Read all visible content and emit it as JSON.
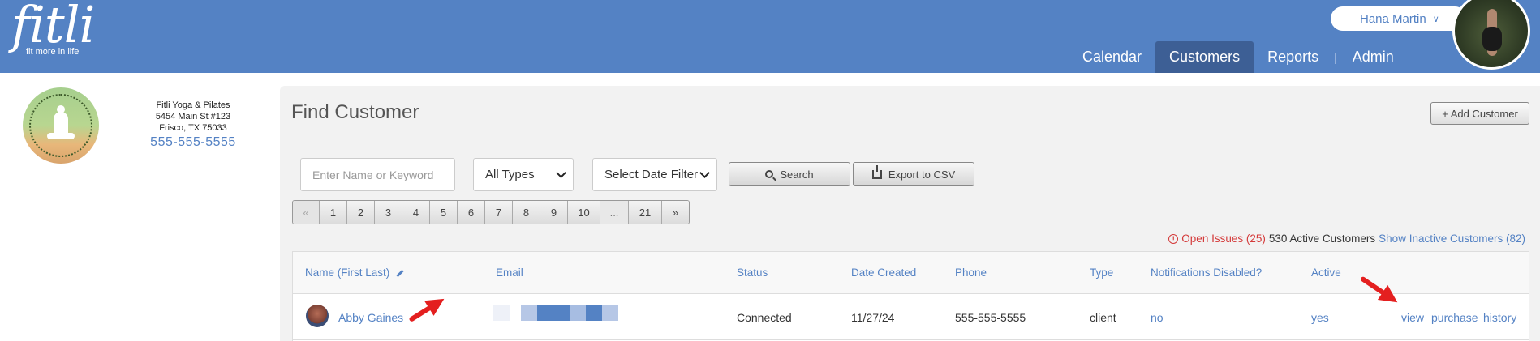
{
  "brand": {
    "name": "fitli",
    "tagline": "fit more in life"
  },
  "user": {
    "name": "Hana Martin"
  },
  "nav": {
    "items": [
      "Calendar",
      "Customers",
      "Reports",
      "Admin"
    ],
    "active": "Customers"
  },
  "studio": {
    "name": "Fitli Yoga & Pilates",
    "address1": "5454 Main St #123",
    "address2": "Frisco, TX 75033",
    "phone": "555-555-5555"
  },
  "page": {
    "title": "Find Customer",
    "add_label": "+ Add Customer"
  },
  "filters": {
    "keyword_placeholder": "Enter Name or Keyword",
    "type_value": "All Types",
    "date_value": "Select Date Filter",
    "search_label": "Search",
    "export_label": "Export to CSV"
  },
  "pagination": {
    "prev": "«",
    "pages": [
      "1",
      "2",
      "3",
      "4",
      "5",
      "6",
      "7",
      "8",
      "9",
      "10"
    ],
    "gap": "...",
    "last": "21",
    "next": "»"
  },
  "stats": {
    "open_issues": "Open Issues (25)",
    "active": "530 Active Customers",
    "inactive": "Show Inactive Customers (82)"
  },
  "table": {
    "headers": [
      "Name (First Last)",
      "Email",
      "Status",
      "Date Created",
      "Phone",
      "Type",
      "Notifications Disabled?",
      "Active"
    ],
    "rows": [
      {
        "name": "Abby Gaines",
        "status": "Connected",
        "date_created": "11/27/24",
        "phone": "555-555-5555",
        "type": "client",
        "notifications_disabled": "no",
        "active": "yes",
        "actions": [
          "view",
          "purchase",
          "history"
        ]
      }
    ]
  },
  "colors": {
    "brand_blue": "#5482c4",
    "nav_active": "#3d5f95",
    "annotation_red": "#e41f1f",
    "warning_red": "#d43a3a"
  }
}
